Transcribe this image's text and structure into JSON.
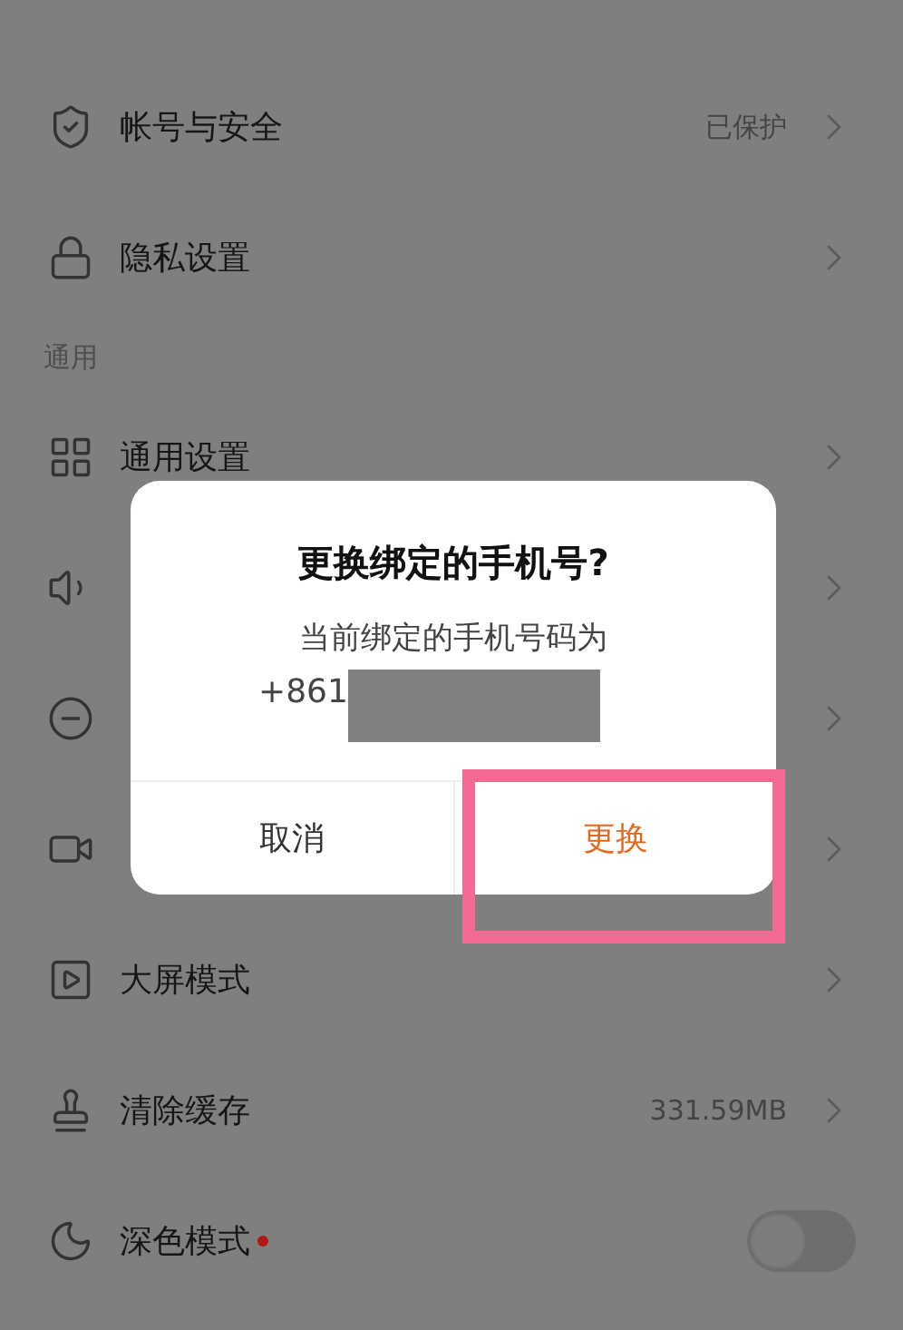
{
  "sections": [
    {
      "rows": [
        {
          "kind": "link",
          "label": "帐号与安全",
          "value": "已保护"
        },
        {
          "kind": "link",
          "label": "隐私设置"
        }
      ]
    },
    {
      "header": "通用",
      "rows": [
        {
          "kind": "link",
          "label": "通用设置"
        },
        {
          "kind": "link"
        },
        {
          "kind": "link"
        },
        {
          "kind": "link"
        },
        {
          "kind": "link",
          "label": "大屏模式"
        },
        {
          "kind": "link",
          "label": "清除缓存",
          "value": "331.59MB"
        },
        {
          "kind": "switch",
          "label": "深色模式",
          "dot": true,
          "on": false
        }
      ]
    }
  ],
  "dialog": {
    "title": "更换绑定的手机号?",
    "message": "当前绑定的手机号码为",
    "phone": "+861",
    "masked": true,
    "buttons": [
      {
        "label": "取消",
        "primary": false,
        "highlighted": false
      },
      {
        "label": "更换",
        "primary": true,
        "highlighted": true
      }
    ]
  }
}
